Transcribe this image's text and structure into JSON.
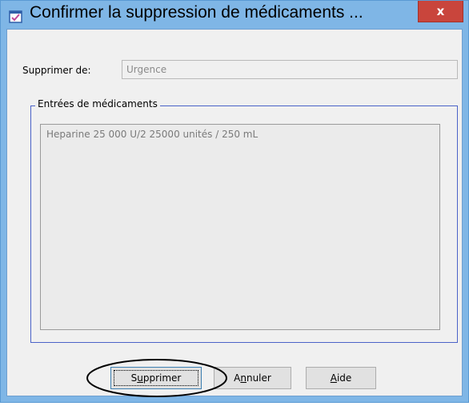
{
  "window": {
    "title": "Confirmer la suppression de médicaments ...",
    "close_label": "x"
  },
  "form": {
    "from_label": "Supprimer de:",
    "from_value": "Urgence"
  },
  "group": {
    "legend": "Entrées de médicaments",
    "items": [
      "Heparine 25 000  U/2 25000 unités / 250 mL"
    ]
  },
  "buttons": {
    "delete": {
      "prefix": "S",
      "mnemonic": "u",
      "rest": "pprimer"
    },
    "cancel": {
      "prefix": "A",
      "mnemonic": "n",
      "rest": "nuler"
    },
    "help": {
      "prefix": "",
      "mnemonic": "A",
      "rest": "ide"
    }
  },
  "colors": {
    "title_bar": "#7fb6e6",
    "close_button": "#c9453c",
    "group_border": "#4a62c8",
    "annotation": "#000000"
  },
  "icons": {
    "app": "checked-clipboard-icon",
    "close": "close-icon"
  }
}
